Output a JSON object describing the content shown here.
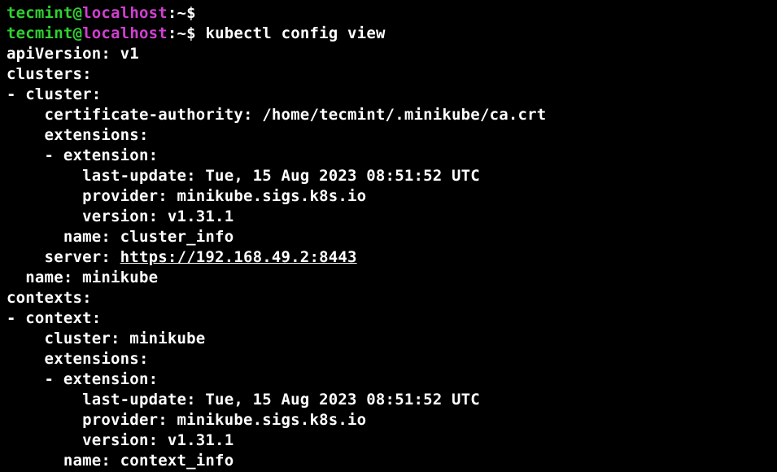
{
  "prompt1": {
    "user": "tecmint",
    "at": "@",
    "host": "localhost",
    "sep": ":",
    "path": "~",
    "sym": "$"
  },
  "prompt2": {
    "user": "tecmint",
    "at": "@",
    "host": "localhost",
    "sep": ":",
    "path": "~",
    "sym": "$",
    "command": "kubectl config view"
  },
  "out": {
    "l01": "apiVersion: v1",
    "l02": "clusters:",
    "l03": "- cluster:",
    "l04": "    certificate-authority: /home/tecmint/.minikube/ca.crt",
    "l05": "    extensions:",
    "l06": "    - extension:",
    "l07": "        last-update: Tue, 15 Aug 2023 08:51:52 UTC",
    "l08": "        provider: minikube.sigs.k8s.io",
    "l09": "        version: v1.31.1",
    "l10": "      name: cluster_info",
    "l11a": "    server: ",
    "l11b": "https://192.168.49.2:8443",
    "l12": "  name: minikube",
    "l13": "contexts:",
    "l14": "- context:",
    "l15": "    cluster: minikube",
    "l16": "    extensions:",
    "l17": "    - extension:",
    "l18": "        last-update: Tue, 15 Aug 2023 08:51:52 UTC",
    "l19": "        provider: minikube.sigs.k8s.io",
    "l20": "        version: v1.31.1",
    "l21": "      name: context_info"
  }
}
